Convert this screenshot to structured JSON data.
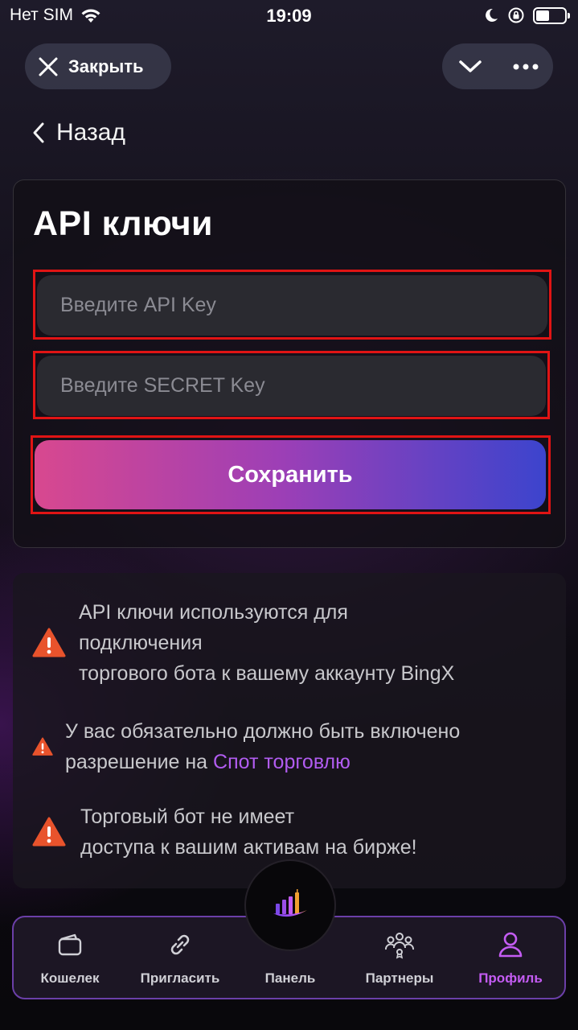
{
  "status_bar": {
    "carrier": "Нет SIM",
    "time": "19:09"
  },
  "header": {
    "close_label": "Закрыть",
    "back_label": "Назад"
  },
  "api_card": {
    "title": "API ключи",
    "api_key_placeholder": "Введите API Key",
    "secret_key_placeholder": "Введите SECRET Key",
    "save_label": "Сохранить"
  },
  "info": {
    "item1_line1": "API ключи используются для",
    "item1_line2": "подключения",
    "item1_line3": "торгового бота к вашему аккаунту BingX",
    "item2_line1": "У вас обязательно должно быть включено",
    "item2_line2_prefix": "разрешение на ",
    "item2_link": "Спот торговлю",
    "item3_line1": "Торговый бот не имеет",
    "item3_line2": "доступа к вашим активам на бирже!"
  },
  "nav": {
    "wallet": "Кошелек",
    "invite": "Пригласить",
    "panel": "Панель",
    "partners": "Партнеры",
    "profile": "Профиль"
  },
  "colors": {
    "accent": "#c45cf3",
    "link": "#b15cf0",
    "highlight_frame": "#e01414",
    "warning": "#e8532c"
  }
}
